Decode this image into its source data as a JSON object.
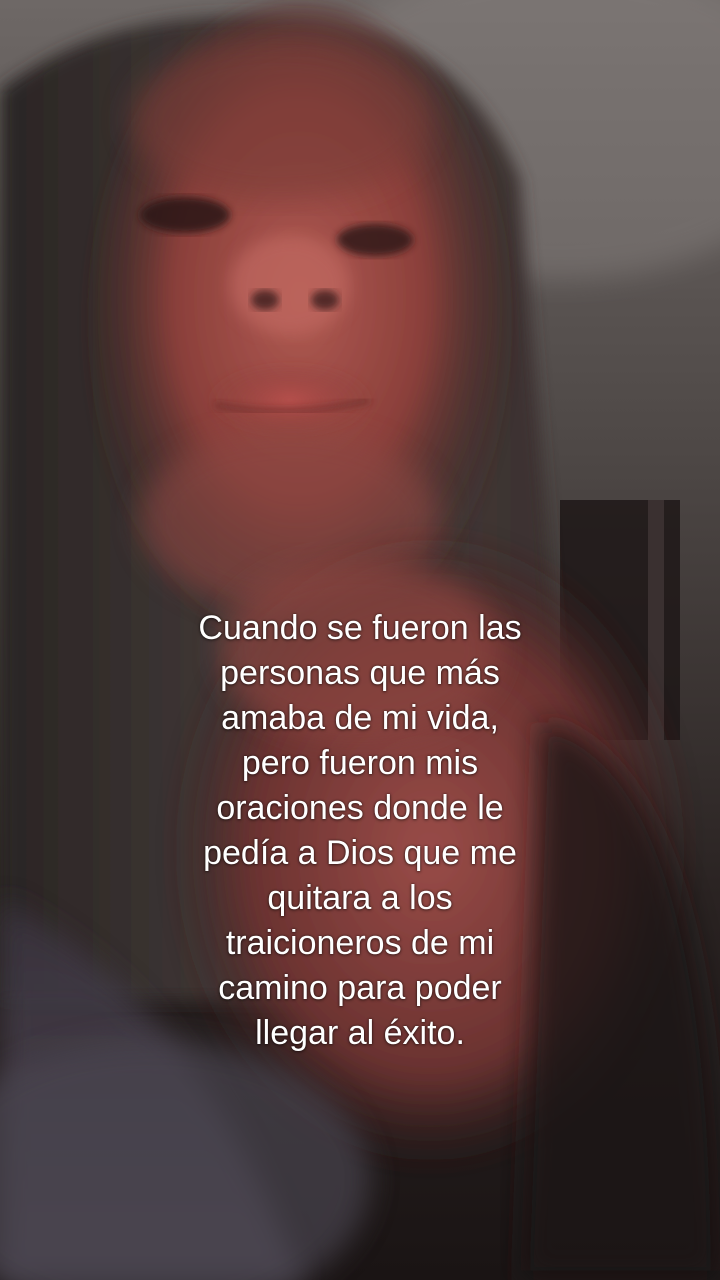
{
  "caption": {
    "lines": [
      "Cuando se fueron las",
      "personas que más",
      "amaba de mi vida,",
      "pero fueron mis",
      "oraciones donde le",
      "pedía a Dios que me",
      "quitara a los",
      "traicioneros de mi",
      "camino para poder",
      "llegar al éxito."
    ]
  },
  "colors": {
    "caption_text": "#ffffff",
    "background_dark": "#1a1414",
    "skin_tone": "#a8544c",
    "hair": "#3a302e",
    "ceiling": "#7a7472"
  }
}
